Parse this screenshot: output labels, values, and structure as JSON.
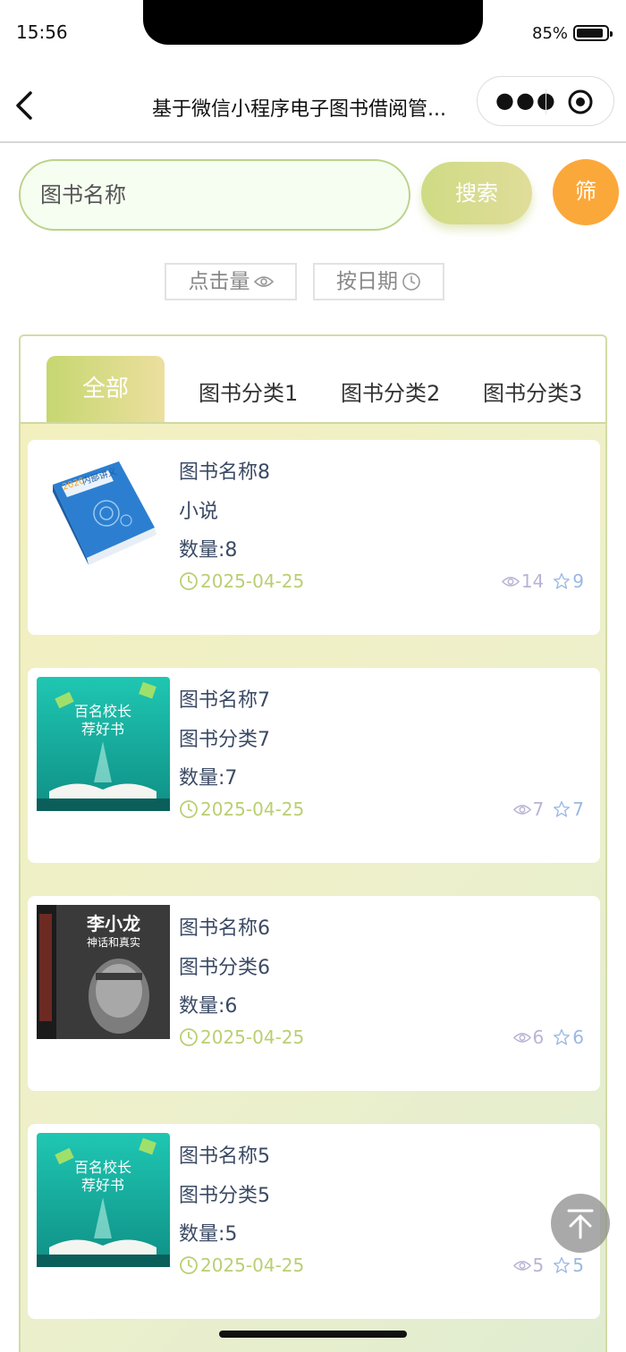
{
  "status_bar": {
    "time": "15:56",
    "battery": "85%"
  },
  "nav": {
    "title": "基于微信小程序电子图书借阅管..."
  },
  "search": {
    "placeholder": "图书名称",
    "button": "搜索",
    "filter": "筛"
  },
  "sort": {
    "hits": "点击量",
    "date": "按日期"
  },
  "tabs": [
    "全部",
    "图书分类1",
    "图书分类2",
    "图书分类3"
  ],
  "books": [
    {
      "name": "图书名称8",
      "category": "小说",
      "quantity": "数量:8",
      "date": "2025-04-25",
      "views": "14",
      "favorites": "9",
      "cover": "blue-textbook-cover"
    },
    {
      "name": "图书名称7",
      "category": "图书分类7",
      "quantity": "数量:7",
      "date": "2025-04-25",
      "views": "7",
      "favorites": "7",
      "cover": "teal-open-book-cover"
    },
    {
      "name": "图书名称6",
      "category": "图书分类6",
      "quantity": "数量:6",
      "date": "2025-04-25",
      "views": "6",
      "favorites": "6",
      "cover": "dark-portrait-cover",
      "cover_text": {
        "main": "李小龙",
        "sub": "神话和真实"
      }
    },
    {
      "name": "图书名称5",
      "category": "图书分类5",
      "quantity": "数量:5",
      "date": "2025-04-25",
      "views": "5",
      "favorites": "5",
      "cover": "teal-open-book-cover"
    }
  ],
  "teal_cover_text": {
    "line1": "百名校长",
    "line2": "荐好书"
  },
  "blue_cover_text": {
    "year": "2020",
    "title": "内部讲义"
  }
}
